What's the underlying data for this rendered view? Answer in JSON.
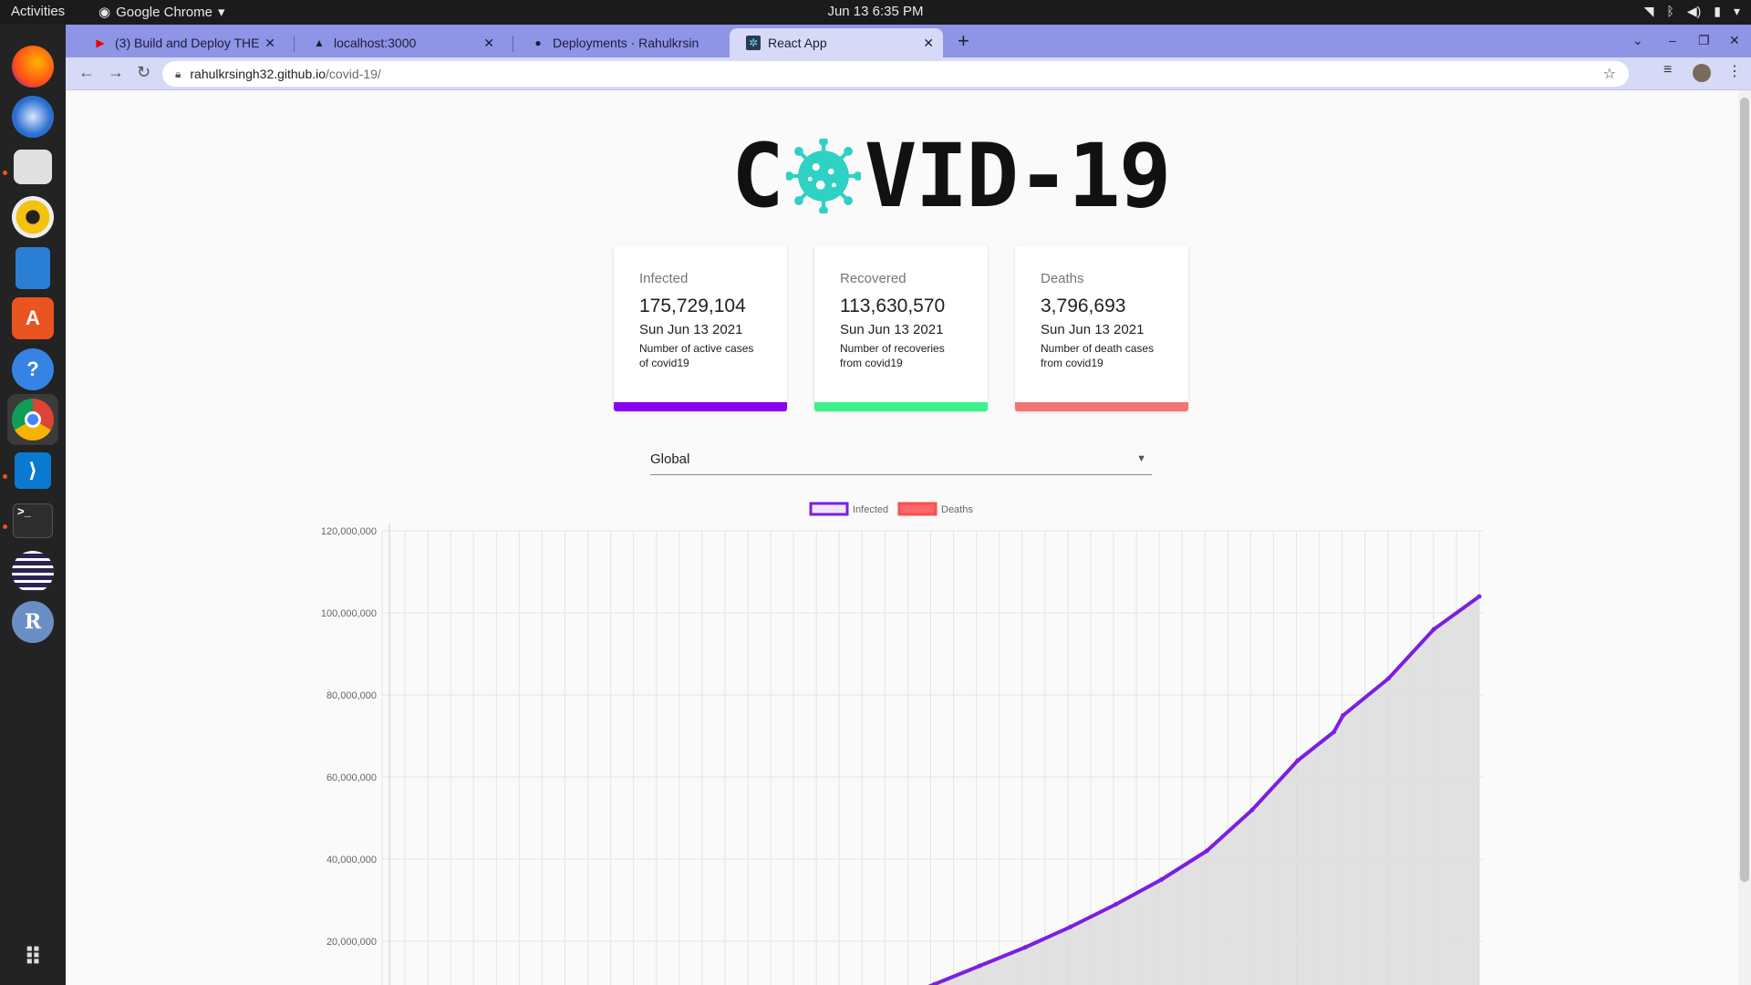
{
  "os": {
    "activities": "Activities",
    "app_name": "Google Chrome",
    "clock": "Jun 13  6:35 PM"
  },
  "browser": {
    "tabs": [
      {
        "label": "(3) Build and Deploy THE",
        "icon": "youtube-icon"
      },
      {
        "label": "localhost:3000",
        "icon": "triangle-icon"
      },
      {
        "label": "Deployments · Rahulkrsin",
        "icon": "github-icon"
      },
      {
        "label": "React App",
        "icon": "react-icon",
        "active": true
      }
    ],
    "url_host": "rahulkrsingh32.github.io",
    "url_path": "/covid-19/"
  },
  "page": {
    "logo_left": "C",
    "logo_right": "VID-19",
    "cards": [
      {
        "label": "Infected",
        "value": "175,729,104",
        "date": "Sun Jun 13 2021",
        "description": "Number of active cases of covid19",
        "color": "#8a00f2"
      },
      {
        "label": "Recovered",
        "value": "113,630,570",
        "date": "Sun Jun 13 2021",
        "description": "Number of recoveries from covid19",
        "color": "#3df28a"
      },
      {
        "label": "Deaths",
        "value": "3,796,693",
        "date": "Sun Jun 13 2021",
        "description": "Number of death cases from covid19",
        "color": "#f27474"
      }
    ],
    "country_select": {
      "value": "Global"
    }
  },
  "chart_data": {
    "type": "line",
    "title": "",
    "xlabel": "",
    "ylabel": "",
    "legend": "top-center",
    "ylim": [
      0,
      120000000
    ],
    "yticks": [
      "120,000,000",
      "100,000,000",
      "80,000,000",
      "60,000,000",
      "40,000,000",
      "20,000,000"
    ],
    "grid": true,
    "x_index_range": [
      0,
      120
    ],
    "series": [
      {
        "name": "Infected",
        "color": "#7b1fe0",
        "fill": "#dcdcdc",
        "x_index": [
          47,
          50,
          55,
          60,
          65,
          70,
          75,
          80,
          85,
          90,
          95,
          100,
          104,
          105,
          110,
          115,
          120
        ],
        "values": [
          0,
          1000000,
          5000000,
          9500000,
          14000000,
          18500000,
          23500000,
          29000000,
          35000000,
          42000000,
          52000000,
          64000000,
          71000000,
          75000000,
          84000000,
          96000000,
          104000000
        ]
      },
      {
        "name": "Deaths",
        "color": "#ff4d4d",
        "values": []
      }
    ]
  }
}
